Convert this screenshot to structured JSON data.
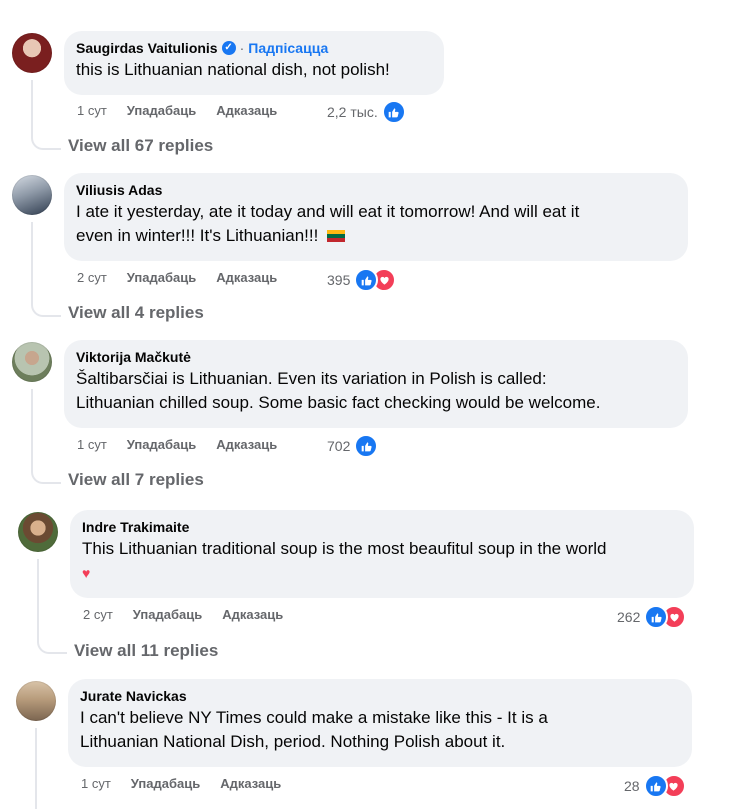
{
  "comments": [
    {
      "author": "Saugirdas Vaitulionis",
      "verified": true,
      "follow_label": "Падпісацца",
      "text": "this is Lithuanian national dish, not polish!",
      "time": "1 сут",
      "like_label": "Упадабаць",
      "reply_label": "Адказаць",
      "reaction_count": "2,2 тыс.",
      "reactions": [
        "like"
      ],
      "replies_label": "View all 67 replies"
    },
    {
      "author": "Viliusis Adas",
      "text_line1": "I ate it yesterday, ate it today and will eat it tomorrow! And will eat it",
      "text_line2": "even in winter!!! It's Lithuanian!!!",
      "flag": "lithuania-flag",
      "time": "2 сут",
      "like_label": "Упадабаць",
      "reply_label": "Адказаць",
      "reaction_count": "395",
      "reactions": [
        "like",
        "love"
      ],
      "replies_label": "View all 4 replies"
    },
    {
      "author": "Viktorija Mačkutė",
      "text_line1": "Šaltibarsčiai is Lithuanian. Even its variation in Polish is called:",
      "text_line2": "Lithuanian chilled soup. Some basic fact checking would be welcome.",
      "time": "1 сут",
      "like_label": "Упадабаць",
      "reply_label": "Адказаць",
      "reaction_count": "702",
      "reactions": [
        "like"
      ],
      "replies_label": "View all 7 replies"
    },
    {
      "author": "Indre Trakimaite",
      "text_line1": "This Lithuanian traditional soup is the most beaufitul soup in the world",
      "emoji": "❤️",
      "time": "2 сут",
      "like_label": "Упадабаць",
      "reply_label": "Адказаць",
      "reaction_count": "262",
      "reactions": [
        "like",
        "love"
      ],
      "replies_label": "View all 11 replies"
    },
    {
      "author": "Jurate Navickas",
      "text_line1": "I can't believe NY Times could make a mistake like this - It is a",
      "text_line2": "Lithuanian National Dish, period. Nothing Polish about it.",
      "time": "1 сут",
      "like_label": "Упадабаць",
      "reply_label": "Адказаць",
      "reaction_count": "28",
      "reactions": [
        "like",
        "love"
      ]
    }
  ],
  "colors": {
    "bubble": "#f0f2f5",
    "accent": "#1877f2",
    "love": "#f33e58",
    "muted": "#65676b"
  }
}
